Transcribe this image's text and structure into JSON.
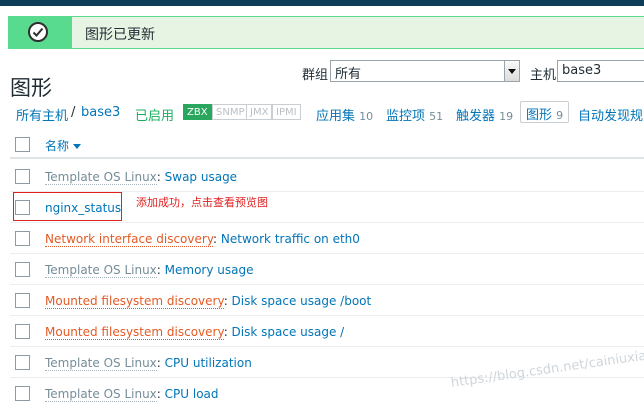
{
  "alert": {
    "message": "图形已更新"
  },
  "page": {
    "title": "图形"
  },
  "filters": {
    "group_label": "群组",
    "group_value": "所有",
    "host_label": "主机",
    "host_value": "base3"
  },
  "breadcrumb": {
    "all_hosts": "所有主机",
    "separator": "/",
    "host": "base3",
    "status": "已启用",
    "availability": [
      "ZBX",
      "SNMP",
      "JMX",
      "IPMI"
    ],
    "tabs": [
      {
        "label": "应用集",
        "count": "10"
      },
      {
        "label": "监控项",
        "count": "51"
      },
      {
        "label": "触发器",
        "count": "19"
      },
      {
        "label": "图形",
        "count": "9"
      },
      {
        "label": "自动发现规则",
        "count": ""
      }
    ]
  },
  "table": {
    "column_name": "名称",
    "rows": [
      {
        "prefix": "Template OS Linux",
        "prefix_type": "template",
        "name": "Swap usage"
      },
      {
        "prefix": "",
        "prefix_type": "",
        "name": "nginx_status"
      },
      {
        "prefix": "Network interface discovery",
        "prefix_type": "discovery",
        "name": "Network traffic on eth0"
      },
      {
        "prefix": "Template OS Linux",
        "prefix_type": "template",
        "name": "Memory usage"
      },
      {
        "prefix": "Mounted filesystem discovery",
        "prefix_type": "discovery",
        "name": "Disk space usage /boot"
      },
      {
        "prefix": "Mounted filesystem discovery",
        "prefix_type": "discovery",
        "name": "Disk space usage /"
      },
      {
        "prefix": "Template OS Linux",
        "prefix_type": "template",
        "name": "CPU utilization"
      },
      {
        "prefix": "Template OS Linux",
        "prefix_type": "template",
        "name": "CPU load"
      }
    ]
  },
  "annotation": {
    "text": "添加成功，点击查看预览图"
  },
  "watermark": {
    "text": "https://blog.csdn.net/cainiuxiaowi"
  },
  "colors": {
    "accent": "#0275b8",
    "success": "#59db8f",
    "discovery": "#e45a24",
    "annotation": "#e01f1f"
  }
}
